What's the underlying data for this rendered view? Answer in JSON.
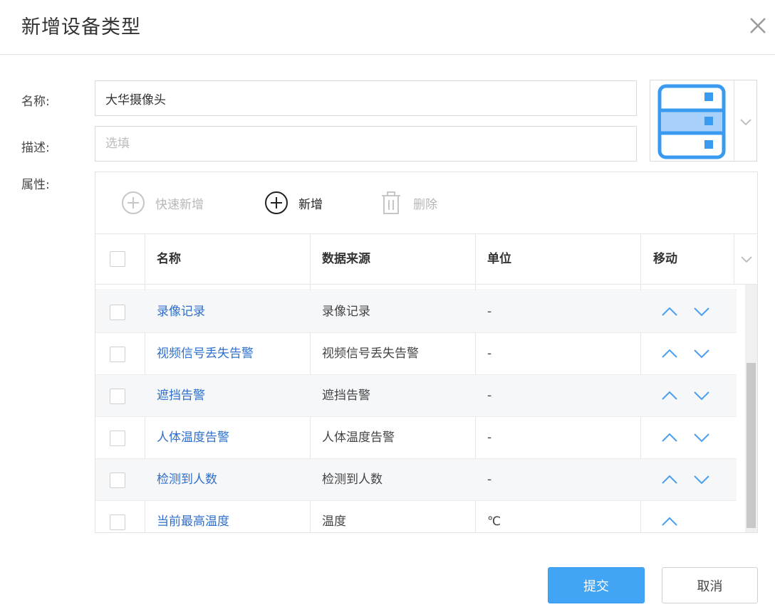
{
  "dialog": {
    "title": "新增设备类型"
  },
  "form": {
    "name_label": "名称:",
    "name_value": "大华摄像头",
    "desc_label": "描述:",
    "desc_placeholder": "选填",
    "attr_label": "属性:"
  },
  "icon_picker": {
    "selected_icon": "server-rack-icon",
    "accent": "#3a9af0",
    "fill": "#a7d0fb"
  },
  "toolbar": {
    "quick_add": "快速新增",
    "add": "新增",
    "delete": "删除"
  },
  "table": {
    "columns": [
      "名称",
      "数据来源",
      "单位",
      "移动"
    ],
    "rows": [
      {
        "name": "录像记录",
        "source": "录像记录",
        "unit": "-"
      },
      {
        "name": "视频信号丢失告警",
        "source": "视频信号丢失告警",
        "unit": "-"
      },
      {
        "name": "遮挡告警",
        "source": "遮挡告警",
        "unit": "-"
      },
      {
        "name": "人体温度告警",
        "source": "人体温度告警",
        "unit": "-"
      },
      {
        "name": "检测到人数",
        "source": "检测到人数",
        "unit": "-"
      },
      {
        "name": "当前最高温度",
        "source": "温度",
        "unit": "℃"
      }
    ]
  },
  "actions": {
    "submit": "提交",
    "cancel": "取消"
  },
  "colors": {
    "link": "#2f6fcb",
    "primary": "#42a4f5",
    "arrow": "#4a9ff0"
  }
}
